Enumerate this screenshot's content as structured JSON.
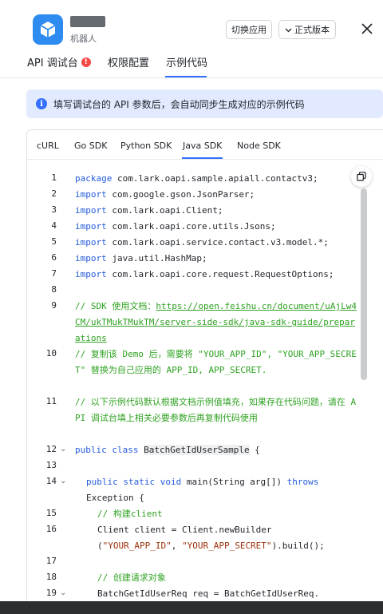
{
  "header": {
    "subtitle": "机器人",
    "switch_app": "切换应用",
    "version": "正式版本"
  },
  "tabs": {
    "api_console": "API 调试台",
    "api_badge": "!",
    "permissions": "权限配置",
    "example_code": "示例代码"
  },
  "info": {
    "icon_glyph": "i",
    "text": "填写调试台的 API 参数后，会自动同步生成对应的示例代码"
  },
  "lang_tabs": [
    "cURL",
    "Go SDK",
    "Python SDK",
    "Java SDK",
    "Node SDK"
  ],
  "code": {
    "line_numbers": [
      "1",
      "2",
      "3",
      "4",
      "5",
      "6",
      "7",
      "8",
      "9",
      "10",
      "11",
      "12",
      "13",
      "14",
      "15",
      "16",
      "17",
      "18",
      "19"
    ],
    "l1_kw": "package",
    "l1_rest": " com.lark.oapi.sample.apiall.contactv3;",
    "l2_kw": "import",
    "l2_rest": " com.google.gson.JsonParser;",
    "l3_kw": "import",
    "l3_rest": " com.lark.oapi.Client;",
    "l4_kw": "import",
    "l4_rest": " com.lark.oapi.core.utils.Jsons;",
    "l5_kw": "import",
    "l5_rest": " com.lark.oapi.service.contact.v3.model.*;",
    "l6_kw": "import",
    "l6_rest": " java.util.HashMap;",
    "l7_kw": "import",
    "l7_rest": " com.lark.oapi.core.request.RequestOptions;",
    "l9_prefix": "// SDK 使用文档：",
    "l9_link": "https://open.feishu.cn/document/uAjLw4CM/ukTMukTMukTM/server-side-sdk/java-sdk-guide/preparations",
    "l10": "// 复制该 Demo 后，需要将 \"YOUR_APP_ID\", \"YOUR_APP_SECRET\" 替换为自己应用的 APP_ID, APP_SECRET.",
    "l11": "// 以下示例代码默认根据文档示例值填充，如果存在代码问题，请在 API 调试台填上相关必要参数后再复制代码使用",
    "l12_kw": "public class",
    "l12_cls": "BatchGetIdUserSample",
    "l12_brace": " {",
    "l14_kw": "public static void",
    "l14_mid": " main(String arg[]) ",
    "l14_throws": "throws",
    "l14b": "Exception {",
    "l15": "// 构建client",
    "l16": "Client client = Client.newBuilder",
    "l16b_str1": "\"YOUR_APP_ID\"",
    "l16b_str2": "\"YOUR_APP_SECRET\"",
    "l16b_end": ").build();",
    "l18": "// 创建请求对象",
    "l19": "BatchGetIdUserReq req = BatchGetIdUserReq."
  },
  "colors": {
    "accent": "#3370ff",
    "keyword": "#245bdb",
    "string": "#9c2f0a",
    "comment": "#2ea121",
    "badge": "#f54a45"
  },
  "icons": [
    "cube-icon",
    "chevron-down-icon",
    "close-icon",
    "info-icon",
    "copy-icon",
    "fold-chevron-icon"
  ]
}
